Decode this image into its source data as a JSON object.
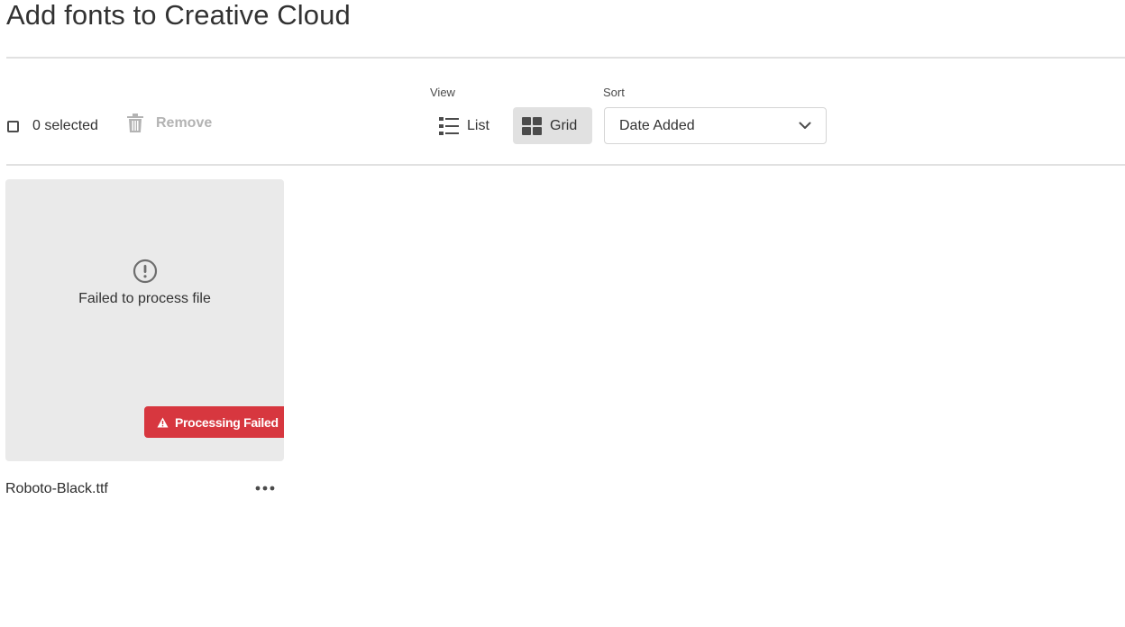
{
  "page": {
    "title": "Add fonts to Creative Cloud"
  },
  "toolbar": {
    "selected_count": "0 selected",
    "remove_label": "Remove",
    "view_label": "View",
    "view_options": [
      {
        "label": "List",
        "icon": "list-icon",
        "active": false
      },
      {
        "label": "Grid",
        "icon": "grid-icon",
        "active": true
      }
    ],
    "sort_label": "Sort",
    "sort_value": "Date Added"
  },
  "files": [
    {
      "name": "Roboto-Black.ttf",
      "error_message": "Failed to process file",
      "status": "Processing Failed",
      "status_color": "#d7373f"
    }
  ],
  "colors": {
    "accent_error": "#d7373f",
    "selected_toggle_bg": "#e1e1e1",
    "card_bg": "#eaeaea"
  }
}
